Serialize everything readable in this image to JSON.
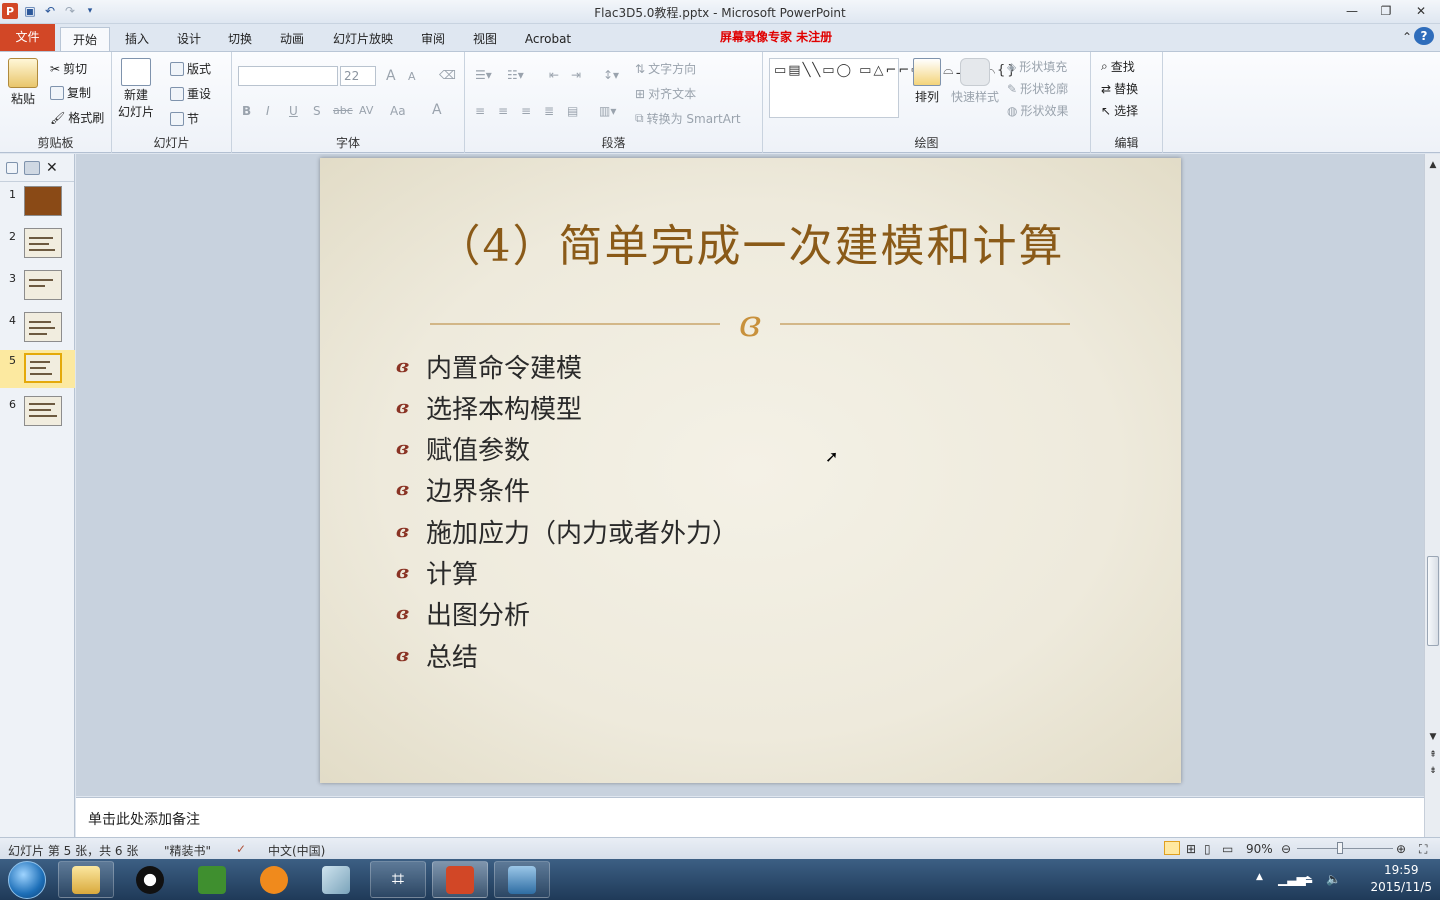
{
  "window": {
    "title": "Flac3D5.0教程.pptx - Microsoft PowerPoint",
    "watermark": "屏幕录像专家  未注册",
    "app_icon": "P"
  },
  "tabs": [
    "文件",
    "开始",
    "插入",
    "设计",
    "切换",
    "动画",
    "幻灯片放映",
    "审阅",
    "视图",
    "Acrobat"
  ],
  "ribbon": {
    "clipboard": {
      "label": "剪贴板",
      "paste": "粘贴",
      "cut": "剪切",
      "copy": "复制",
      "format_painter": "格式刷"
    },
    "slides": {
      "label": "幻灯片",
      "new_slide_l1": "新建",
      "new_slide_l2": "幻灯片",
      "layout": "版式",
      "reset": "重设",
      "section": "节"
    },
    "font": {
      "label": "字体",
      "size": "22",
      "bold": "B",
      "italic": "I",
      "underline": "U",
      "shadow": "S",
      "strike": "abc",
      "spacing": "AV",
      "case": "Aa",
      "color": "A",
      "grow": "A",
      "shrink": "A"
    },
    "paragraph": {
      "label": "段落",
      "text_direction": "文字方向",
      "align_text": "对齐文本",
      "smartart": "转换为 SmartArt"
    },
    "drawing": {
      "label": "绘图",
      "arrange": "排列",
      "quick_styles": "快速样式",
      "shape_fill": "形状填充",
      "shape_outline": "形状轮廓",
      "shape_effects": "形状效果"
    },
    "editing": {
      "label": "编辑",
      "find": "查找",
      "replace": "替换",
      "select": "选择"
    }
  },
  "slides_panel": {
    "thumbnails": [
      {
        "num": "1"
      },
      {
        "num": "2"
      },
      {
        "num": "3"
      },
      {
        "num": "4"
      },
      {
        "num": "5"
      },
      {
        "num": "6"
      }
    ],
    "active": "5"
  },
  "slide": {
    "title": "（4）简单完成一次建模和计算",
    "divider_glyph": "ශ",
    "bullet_glyph": "ශ",
    "bullets": [
      "内置命令建模",
      "选择本构模型",
      "赋值参数",
      "边界条件",
      "施加应力（内力或者外力）",
      "计算",
      "出图分析",
      "总结"
    ]
  },
  "notes": {
    "placeholder": "单击此处添加备注"
  },
  "status": {
    "slide_info": "幻灯片 第 5 张，共 6 张",
    "theme": "\"精装书\"",
    "language": "中文(中国)",
    "zoom": "90%"
  },
  "taskbar": {
    "time": "19:59",
    "date": "2015/11/5"
  },
  "colors": {
    "file_tab": "#d24726",
    "title_text": "#8a5a18",
    "bullet": "#8a3324",
    "watermark": "#e00000"
  }
}
